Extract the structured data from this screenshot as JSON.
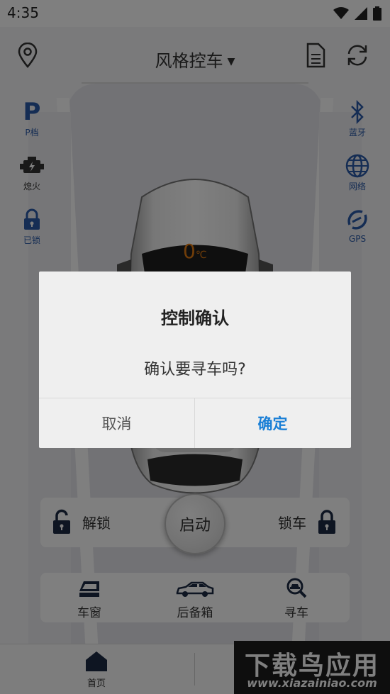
{
  "status_bar": {
    "time": "4:35"
  },
  "header": {
    "title": "风格控车"
  },
  "left_panel": [
    {
      "label": "P档",
      "icon": "p-gear-icon"
    },
    {
      "label": "熄火",
      "icon": "engine-icon"
    },
    {
      "label": "已锁",
      "icon": "lock-icon"
    }
  ],
  "right_panel": [
    {
      "label": "蓝牙",
      "icon": "bluetooth-icon"
    },
    {
      "label": "网络",
      "icon": "globe-icon"
    },
    {
      "label": "GPS",
      "icon": "gps-icon"
    }
  ],
  "car": {
    "temperature": "0",
    "temperature_unit": "℃"
  },
  "controls": {
    "unlock_label": "解锁",
    "start_label": "启动",
    "lock_label": "锁车"
  },
  "functions": [
    {
      "label": "车窗",
      "icon": "window-icon"
    },
    {
      "label": "后备箱",
      "icon": "car-trunk-icon"
    },
    {
      "label": "寻车",
      "icon": "find-car-icon"
    }
  ],
  "bottom_nav": {
    "home_label": "首页"
  },
  "watermark": {
    "title": "下载鸟应用",
    "url": "www.xiazainiao.com"
  },
  "dialog": {
    "title": "控制确认",
    "message": "确认要寻车吗?",
    "cancel_label": "取消",
    "confirm_label": "确定"
  },
  "colors": {
    "accent": "#1a7fd6",
    "icon_blue": "#2a5aa8",
    "overlay": "rgba(0,0,0,0.5)"
  }
}
